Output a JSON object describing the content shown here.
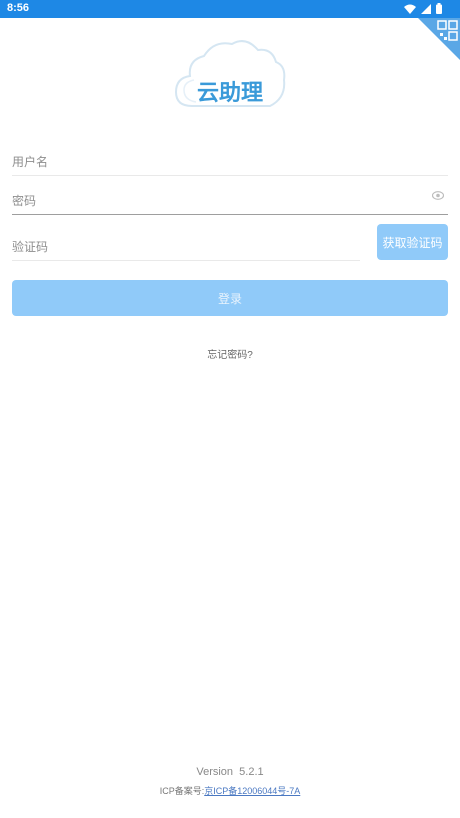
{
  "status_bar": {
    "time": "8:56",
    "icons": [
      "wifi-icon",
      "signal-icon",
      "battery-icon"
    ]
  },
  "header": {
    "corner_icon": "qr-code-icon",
    "logo_text": "云助理"
  },
  "form": {
    "username_placeholder": "用户名",
    "username_value": "",
    "password_placeholder": "密码",
    "password_value": "",
    "captcha_placeholder": "验证码",
    "captcha_value": "",
    "captcha_button_label": "获取验证码",
    "login_button_label": "登录",
    "forgot_password_label": "忘记密码?"
  },
  "footer": {
    "version_label": "Version",
    "version_number": "5.2.1",
    "icp_label": "ICP备案号:",
    "icp_number": "京ICP备12006044号-7A"
  },
  "colors": {
    "status_bar": "#1e88e5",
    "button_disabled": "#90caf9",
    "logo_blue": "#3a9ad9"
  }
}
